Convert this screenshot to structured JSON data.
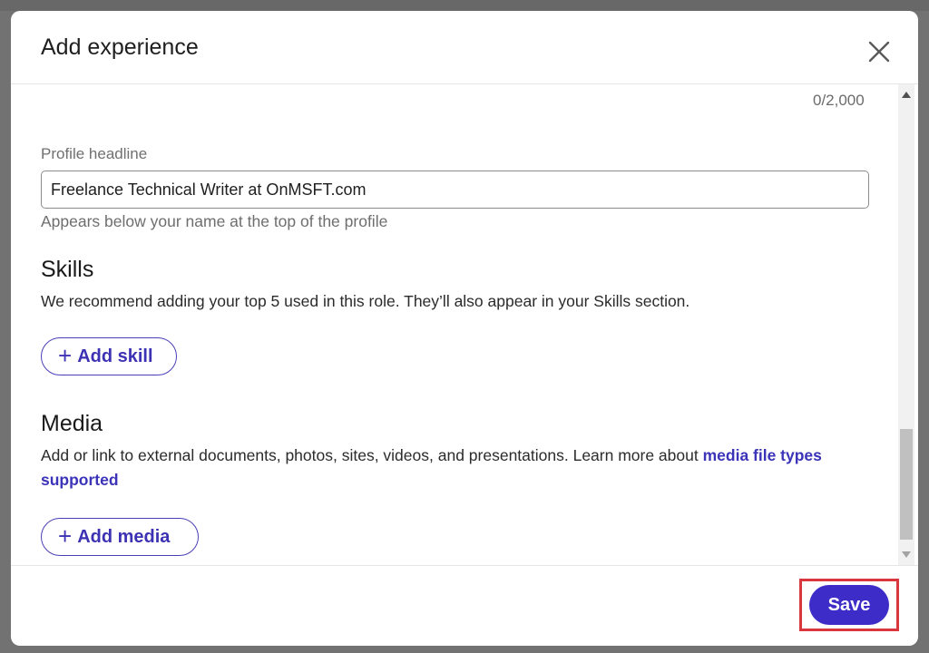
{
  "dialog": {
    "title": "Add experience",
    "close_icon": "close-icon"
  },
  "description_counter": "0/2,000",
  "profile_headline": {
    "label": "Profile headline",
    "value": "Freelance Technical Writer at OnMSFT.com",
    "helper": "Appears below your name at the top of the profile"
  },
  "skills": {
    "title": "Skills",
    "description": "We recommend adding your top 5 used in this role. They’ll also appear in your Skills section.",
    "add_label": "Add skill",
    "add_icon": "plus-icon"
  },
  "media": {
    "title": "Media",
    "description": "Add or link to external documents, photos, sites, videos, and presentations. Learn more about ",
    "link_text": "media file types supported",
    "add_label": "Add media",
    "add_icon": "plus-icon"
  },
  "footer": {
    "save_label": "Save"
  },
  "colors": {
    "accent": "#3d2cc7",
    "link": "#3b33b8",
    "highlight": "#d9363e"
  }
}
